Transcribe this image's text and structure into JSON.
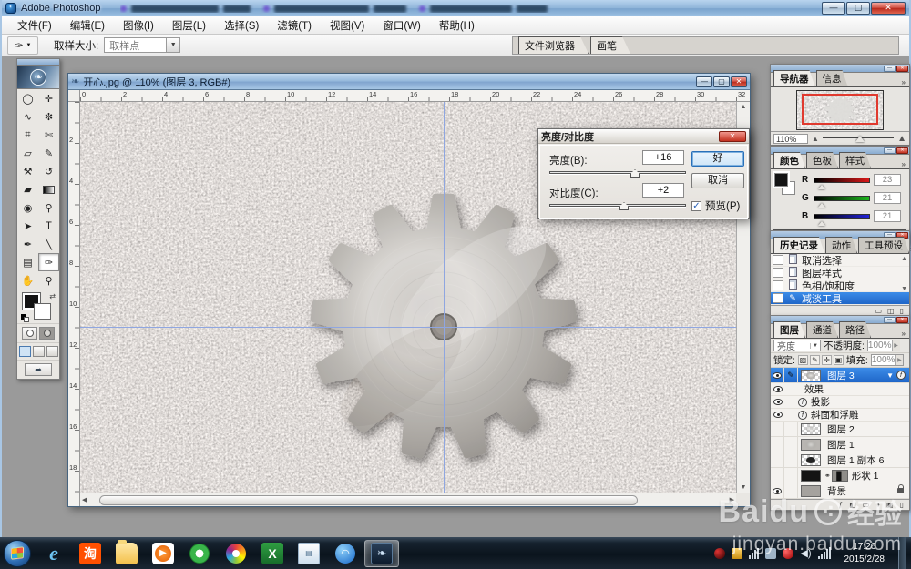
{
  "app": {
    "title": "Adobe Photoshop"
  },
  "menus": [
    "文件(F)",
    "编辑(E)",
    "图像(I)",
    "图层(L)",
    "选择(S)",
    "滤镜(T)",
    "视图(V)",
    "窗口(W)",
    "帮助(H)"
  ],
  "options": {
    "sample_label": "取样大小:",
    "sample_value": "取样点",
    "well_tabs": [
      "文件浏览器",
      "画笔"
    ]
  },
  "tools": [
    {
      "name": "elliptical-marquee",
      "glyph": "◯"
    },
    {
      "name": "move",
      "glyph": "✛"
    },
    {
      "name": "lasso",
      "glyph": "∿"
    },
    {
      "name": "magic-wand",
      "glyph": "✼"
    },
    {
      "name": "crop",
      "glyph": "⌗"
    },
    {
      "name": "slice",
      "glyph": "✄"
    },
    {
      "name": "healing-brush",
      "glyph": "▱"
    },
    {
      "name": "brush",
      "glyph": "✎"
    },
    {
      "name": "clone-stamp",
      "glyph": "⚒"
    },
    {
      "name": "history-brush",
      "glyph": "↺"
    },
    {
      "name": "eraser",
      "glyph": "▰"
    },
    {
      "name": "gradient",
      "glyph": ""
    },
    {
      "name": "blur",
      "glyph": "◉"
    },
    {
      "name": "dodge",
      "glyph": "⚲"
    },
    {
      "name": "path-selection",
      "glyph": "➤"
    },
    {
      "name": "type",
      "glyph": "T"
    },
    {
      "name": "pen",
      "glyph": "✒"
    },
    {
      "name": "line",
      "glyph": "╲"
    },
    {
      "name": "notes",
      "glyph": "▤"
    },
    {
      "name": "eyedropper",
      "glyph": "✑"
    },
    {
      "name": "hand",
      "glyph": "✋"
    },
    {
      "name": "zoom",
      "glyph": "⚲"
    }
  ],
  "document": {
    "title": "开心.jpg @ 110% (图层 3, RGB#)",
    "h_ruler": [
      "0",
      "2",
      "4",
      "6",
      "8",
      "10",
      "12",
      "14",
      "16",
      "18",
      "20",
      "22",
      "24",
      "26",
      "28",
      "30",
      "32"
    ],
    "v_ruler": [
      "2",
      "4",
      "6",
      "8",
      "10",
      "12",
      "14",
      "16",
      "18"
    ]
  },
  "dialog": {
    "title": "亮度/对比度",
    "brightness_label": "亮度(B):",
    "brightness_value": "+16",
    "contrast_label": "对比度(C):",
    "contrast_value": "+2",
    "ok": "好",
    "cancel": "取消",
    "preview": "预览(P)",
    "check_glyph": "✓"
  },
  "panels": {
    "navigator": {
      "tabs": [
        "导航器",
        "信息"
      ],
      "zoom": "110%"
    },
    "color": {
      "tabs": [
        "颜色",
        "色板",
        "样式"
      ],
      "channels": [
        {
          "label": "R",
          "value": "23"
        },
        {
          "label": "G",
          "value": "21"
        },
        {
          "label": "B",
          "value": "21"
        }
      ]
    },
    "history": {
      "tabs": [
        "历史记录",
        "动作",
        "工具预设"
      ],
      "items": [
        "取消选择",
        "图层样式",
        "色相/饱和度",
        "减淡工具"
      ]
    },
    "layers": {
      "tabs": [
        "图层",
        "通道",
        "路径"
      ],
      "blend_mode": "亮度",
      "opacity_label": "不透明度:",
      "opacity": "100%",
      "lock_label": "锁定:",
      "fill_label": "填充:",
      "fill": "100%",
      "rows": [
        {
          "name": "图层 3"
        },
        {
          "name": "效果"
        },
        {
          "name": "投影"
        },
        {
          "name": "斜面和浮雕"
        },
        {
          "name": "图层 2"
        },
        {
          "name": "图层 1"
        },
        {
          "name": "图层 1 副本 6"
        },
        {
          "name": "形状 1"
        },
        {
          "name": "背景"
        }
      ]
    }
  },
  "taskbar": {
    "time": "17:26",
    "date": "2015/2/28"
  },
  "watermark": {
    "brand": "Baidu",
    "suffix": "经验",
    "url": "jingyan.baidu.com"
  }
}
